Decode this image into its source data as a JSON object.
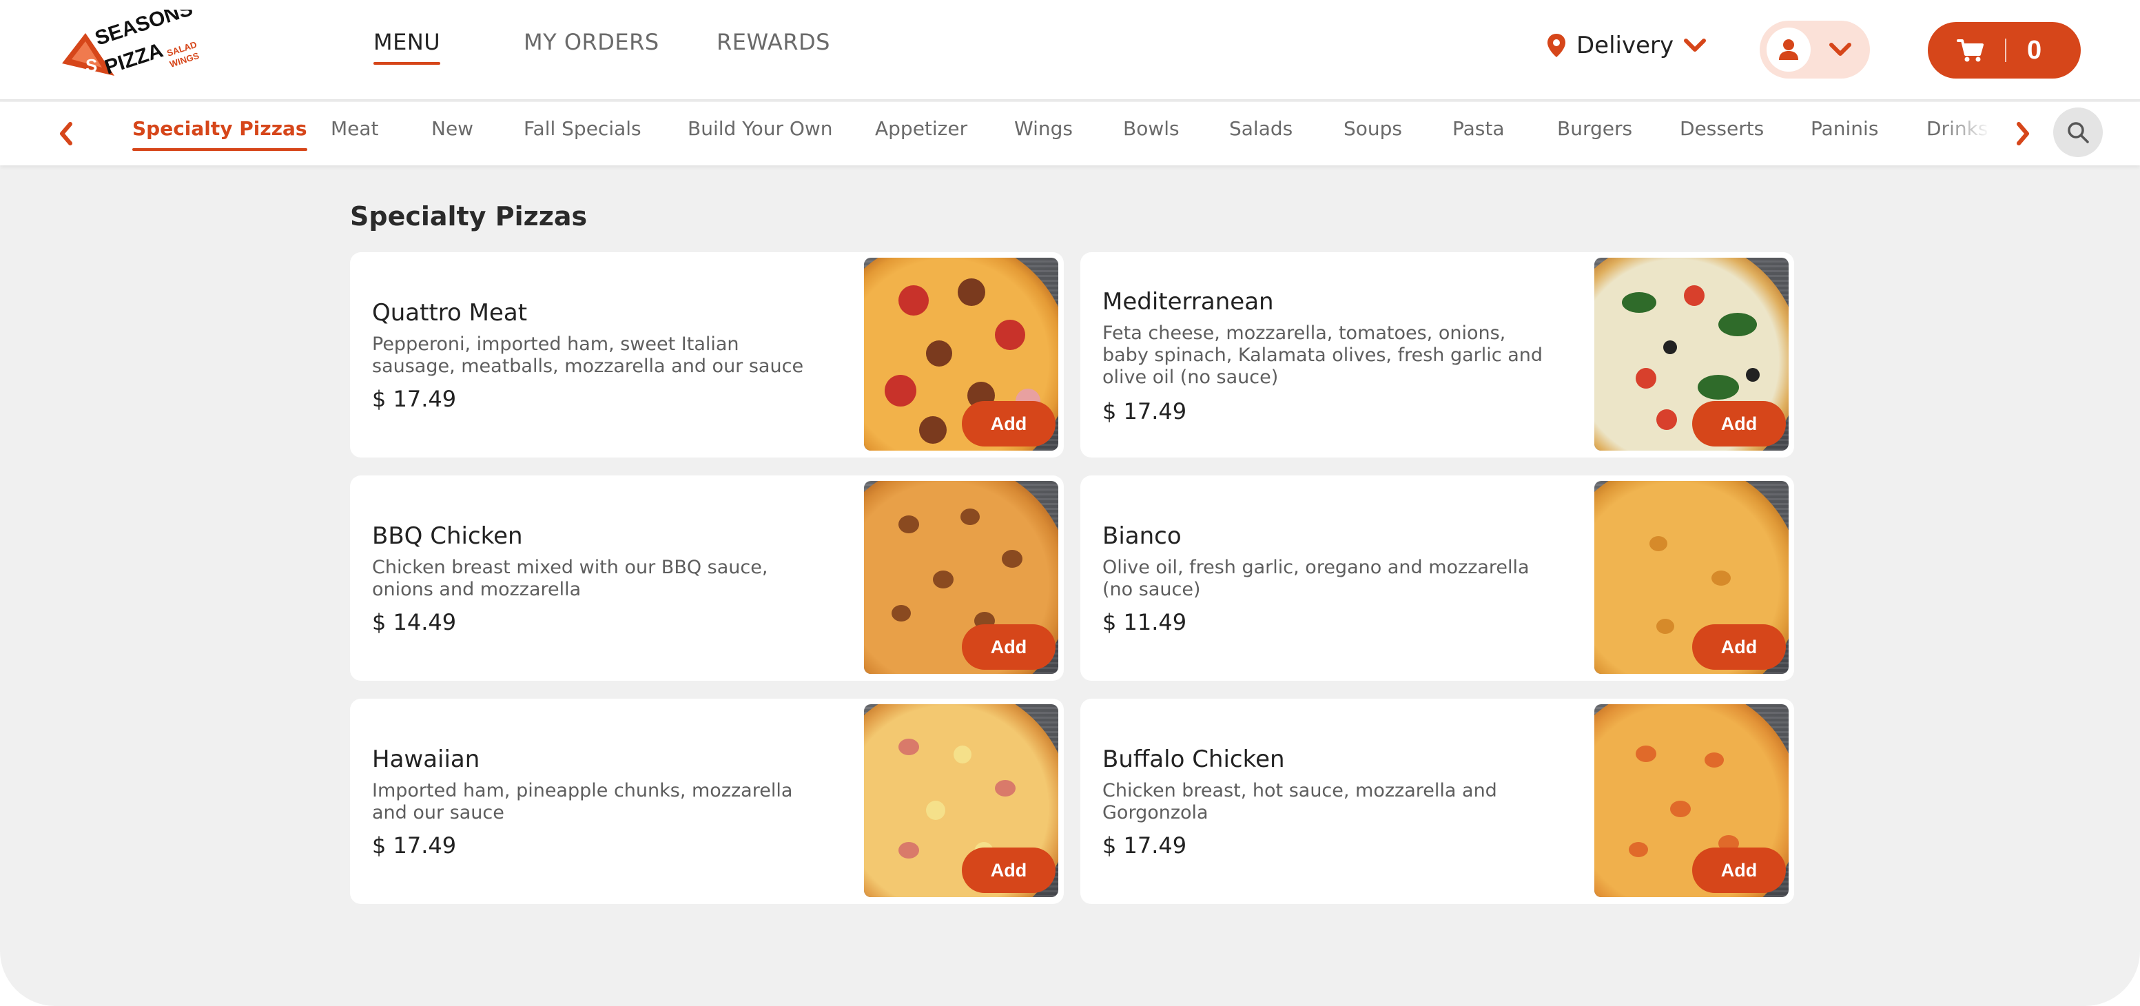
{
  "brand": {
    "logo_line1": "SEASONS",
    "logo_line2": "PIZZA",
    "logo_tag1": "SALAD",
    "logo_tag2": "WINGS",
    "accent_color": "#d6461a"
  },
  "header": {
    "nav": [
      {
        "label": "MENU",
        "active": true
      },
      {
        "label": "MY ORDERS",
        "active": false
      },
      {
        "label": "REWARDS",
        "active": false
      }
    ],
    "delivery_label": "Delivery",
    "cart_count": "0",
    "icons": {
      "location": "location-pin-icon",
      "delivery_chevron": "chevron-down-icon",
      "account": "user-icon",
      "account_chevron": "chevron-down-icon",
      "cart": "cart-icon"
    }
  },
  "categories": {
    "items": [
      "Specialty Pizzas",
      "Meat",
      "New",
      "Fall Specials",
      "Build Your Own",
      "Appetizer",
      "Wings",
      "Bowls",
      "Salads",
      "Soups",
      "Pasta",
      "Burgers",
      "Desserts",
      "Paninis",
      "Drinks"
    ],
    "active": "Specialty Pizzas"
  },
  "section": {
    "title": "Specialty Pizzas",
    "add_label": "Add",
    "products": [
      {
        "name": "Quattro Meat",
        "description": "Pepperoni, imported ham, sweet Italian sausage, meatballs, mozzarella and our sauce",
        "price": "$ 17.49"
      },
      {
        "name": "Mediterranean",
        "description": "Feta cheese, mozzarella, tomatoes, onions, baby spinach, Kalamata olives, fresh garlic and olive oil (no sauce)",
        "price": "$ 17.49"
      },
      {
        "name": "BBQ Chicken",
        "description": "Chicken breast mixed with our BBQ sauce, onions and mozzarella",
        "price": "$ 14.49"
      },
      {
        "name": "Bianco",
        "description": "Olive oil, fresh garlic, oregano and mozzarella (no sauce)",
        "price": "$ 11.49"
      },
      {
        "name": "Hawaiian",
        "description": "Imported ham, pineapple chunks, mozzarella and our sauce",
        "price": "$ 17.49"
      },
      {
        "name": "Buffalo Chicken",
        "description": "Chicken breast, hot sauce, mozzarella and Gorgonzola",
        "price": "$ 17.49"
      }
    ]
  }
}
